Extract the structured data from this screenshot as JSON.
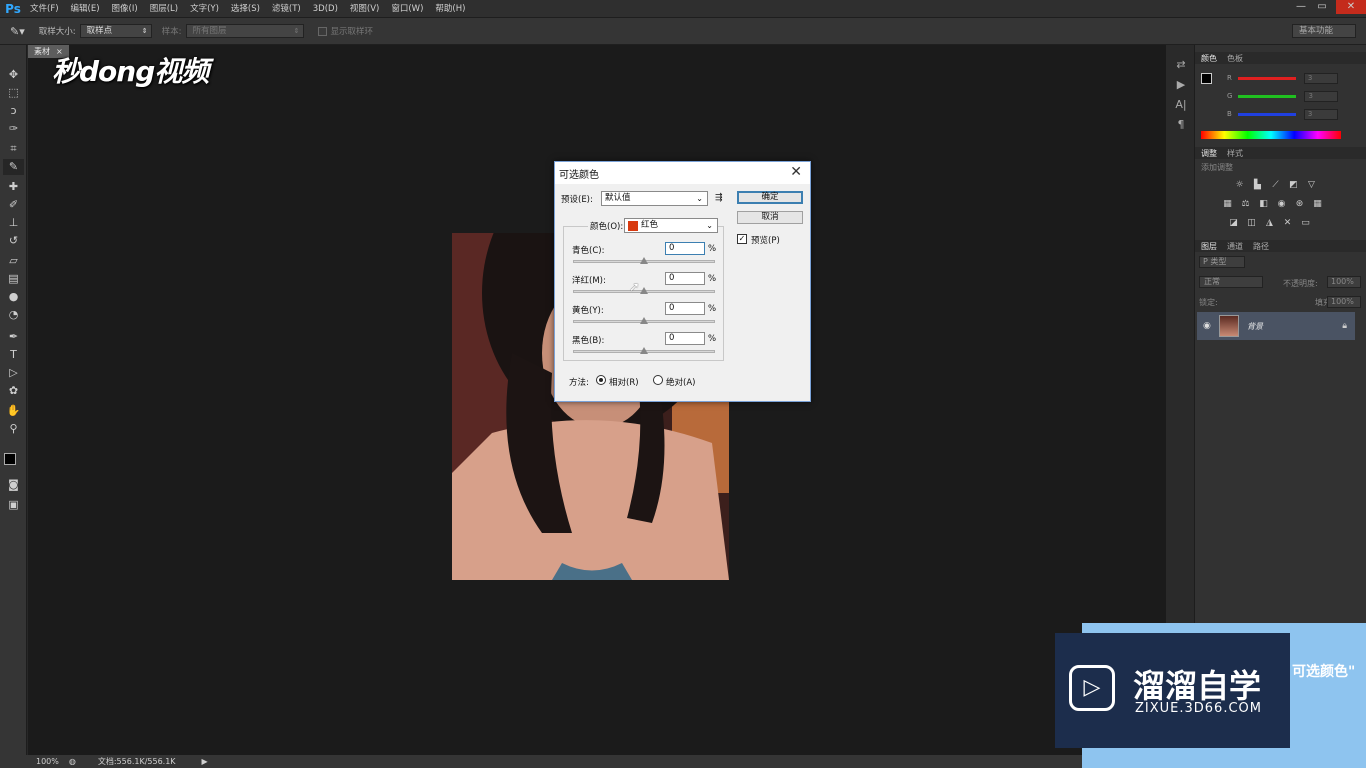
{
  "menubar": {
    "logo": "Ps",
    "items": [
      "文件(F)",
      "编辑(E)",
      "图像(I)",
      "图层(L)",
      "文字(Y)",
      "选择(S)",
      "滤镜(T)",
      "3D(D)",
      "视图(V)",
      "窗口(W)",
      "帮助(H)"
    ],
    "controls": [
      "—",
      "▭",
      "✕"
    ]
  },
  "options": {
    "sample_size_label": "取样大小:",
    "sample_size_value": "取样点",
    "sample_label": "样本:",
    "sample_value": "所有图层",
    "show_ring_label": "显示取样环",
    "workspace": "基本功能"
  },
  "doc_tab": {
    "name": "素材",
    "close": "×"
  },
  "watermark": "秒dong视频",
  "color_panel": {
    "tabs": [
      "颜色",
      "色板"
    ],
    "channels": [
      {
        "name": "R",
        "value": "3",
        "color": "#e02020"
      },
      {
        "name": "G",
        "value": "3",
        "color": "#20c020"
      },
      {
        "name": "B",
        "value": "3",
        "color": "#2040e0"
      }
    ]
  },
  "adjust_panel": {
    "tabs": [
      "调整",
      "样式"
    ],
    "add_label": "添加调整"
  },
  "layers_panel": {
    "tabs": [
      "图层",
      "通道",
      "路径"
    ],
    "filter_label": "P 类型",
    "blend_mode": "正常",
    "opacity_label": "不透明度:",
    "opacity_value": "100%",
    "lock_label": "锁定:",
    "fill_label": "填充:",
    "fill_value": "100%",
    "layer_name": "背景"
  },
  "status": {
    "zoom": "100%",
    "doc": "文档:556.1K/556.1K"
  },
  "dialog": {
    "title": "可选颜色",
    "preset_label": "预设(E):",
    "preset_value": "默认值",
    "ok": "确定",
    "cancel": "取消",
    "preview_label": "预览(P)",
    "colors_label": "颜色(O):",
    "colors_value": "红色",
    "swatch_color": "#d83a10",
    "sliders": [
      {
        "label": "青色(C):",
        "value": "0",
        "pct": "%"
      },
      {
        "label": "洋红(M):",
        "value": "0",
        "pct": "%"
      },
      {
        "label": "黄色(Y):",
        "value": "0",
        "pct": "%"
      },
      {
        "label": "黑色(B):",
        "value": "0",
        "pct": "%"
      }
    ],
    "method_label": "方法:",
    "relative_label": "相对(R)",
    "absolute_label": "绝对(A)"
  },
  "brand": {
    "name": "溜溜自学",
    "url": "ZIXUE.3D66.COM",
    "caption": "可选颜色\""
  }
}
